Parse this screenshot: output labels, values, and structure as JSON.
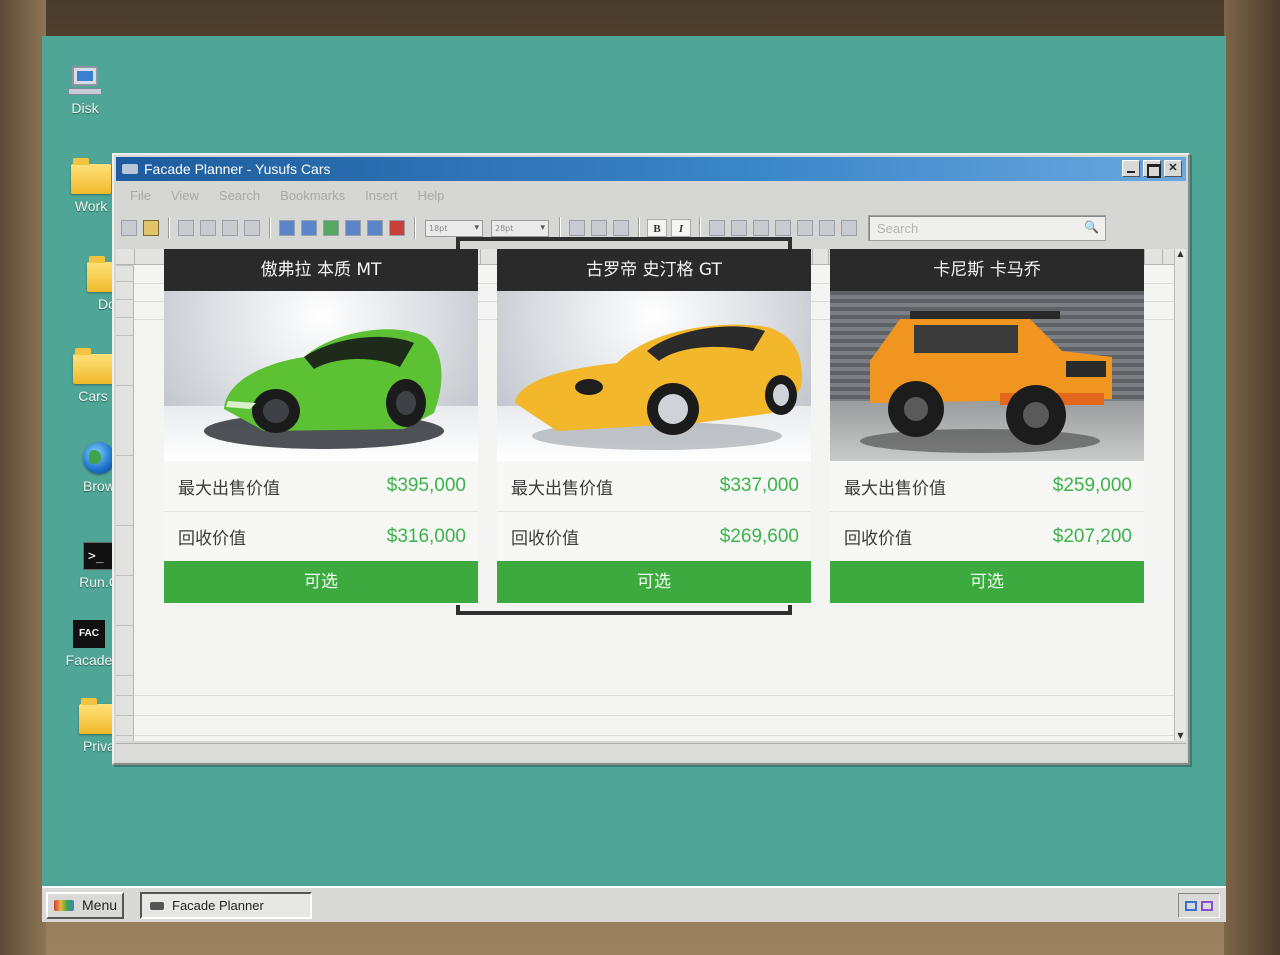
{
  "desktop": {
    "icons": [
      {
        "label": "Disk",
        "icon": "computer-icon"
      },
      {
        "label": "Work",
        "icon": "folder-icon"
      },
      {
        "label": "Do",
        "icon": "folder-icon"
      },
      {
        "label": "Cars",
        "icon": "folder-icon"
      },
      {
        "label": "Brow",
        "icon": "globe-icon"
      },
      {
        "label": "Run.C",
        "icon": "terminal-icon"
      },
      {
        "label": "Facade",
        "icon": "facade-icon"
      },
      {
        "label": "Priva",
        "icon": "folder-icon"
      }
    ],
    "background_color": "#4fa696"
  },
  "window": {
    "title": "Facade Planner - Yusufs Cars",
    "menu": [
      "File",
      "View",
      "Search",
      "Bookmarks",
      "Insert",
      "Help"
    ],
    "search_placeholder": "Search",
    "font_size_value": "18pt",
    "line_size_value": "28pt"
  },
  "cards": [
    {
      "name": "傲弗拉 本质 MT",
      "color_hex": "#5cc133",
      "max_sell_label": "最大出售价值",
      "max_sell_value": "$395,000",
      "buyback_label": "回收价值",
      "buyback_value": "$316,000",
      "button_label": "可选",
      "selected": false
    },
    {
      "name": "古罗帝 史汀格 GT",
      "color_hex": "#f2b72a",
      "max_sell_label": "最大出售价值",
      "max_sell_value": "$337,000",
      "buyback_label": "回收价值",
      "buyback_value": "$269,600",
      "button_label": "可选",
      "selected": true
    },
    {
      "name": "卡尼斯 卡马乔",
      "color_hex": "#f0951f",
      "max_sell_label": "最大出售价值",
      "max_sell_value": "$259,000",
      "buyback_label": "回收价值",
      "buyback_value": "$207,200",
      "button_label": "可选",
      "selected": false
    }
  ],
  "taskbar": {
    "menu_label": "Menu",
    "open_task": "Facade Planner"
  }
}
